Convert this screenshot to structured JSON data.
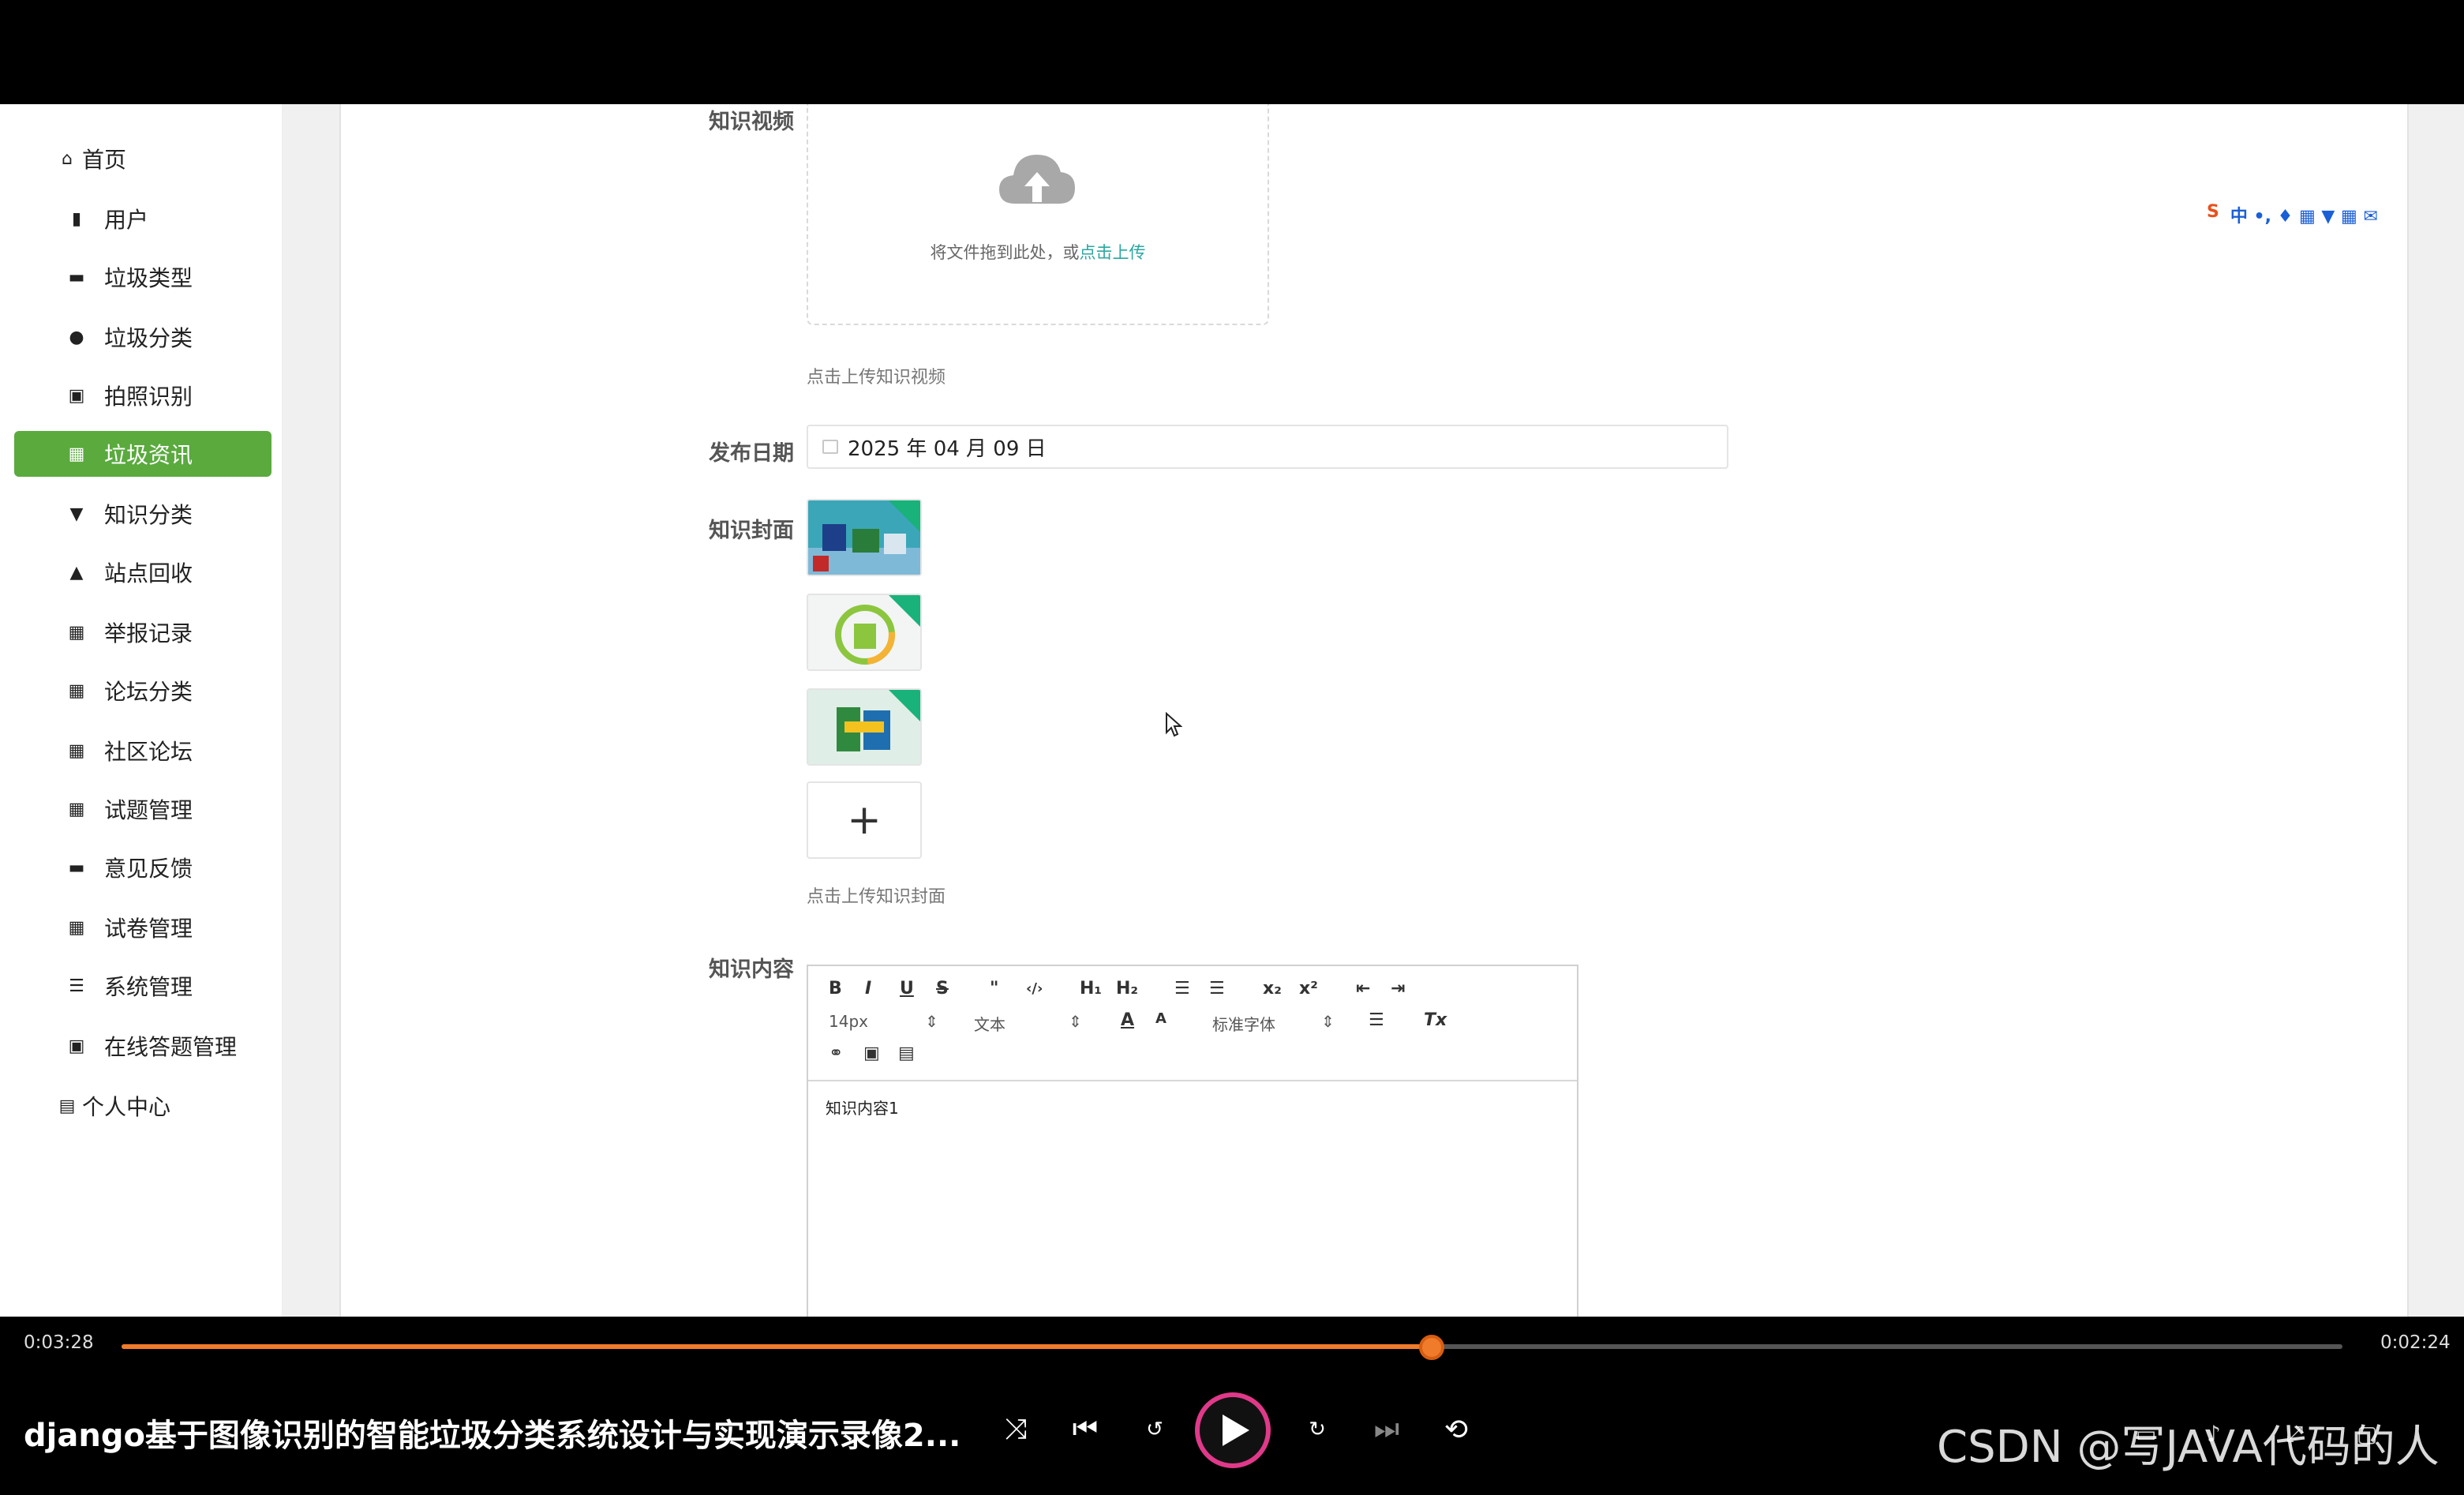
{
  "sidebar": {
    "items": [
      {
        "label": "首页",
        "icon": "home-icon",
        "glyph": "⌂",
        "top": true
      },
      {
        "label": "用户",
        "icon": "clipboard-icon",
        "glyph": "▮"
      },
      {
        "label": "垃圾类型",
        "icon": "monitor-icon",
        "glyph": "▬"
      },
      {
        "label": "垃圾分类",
        "icon": "user-icon",
        "glyph": "●"
      },
      {
        "label": "拍照识别",
        "icon": "clipboard-check-icon",
        "glyph": "▣"
      },
      {
        "label": "垃圾资讯",
        "icon": "grid-icon",
        "glyph": "▦",
        "active": true
      },
      {
        "label": "知识分类",
        "icon": "pin-icon",
        "glyph": "▼"
      },
      {
        "label": "站点回收",
        "icon": "person-icon",
        "glyph": "▲"
      },
      {
        "label": "举报记录",
        "icon": "grid-dots-icon",
        "glyph": "▦"
      },
      {
        "label": "论坛分类",
        "icon": "grid-icon",
        "glyph": "▦"
      },
      {
        "label": "社区论坛",
        "icon": "grid-icon",
        "glyph": "▦"
      },
      {
        "label": "试题管理",
        "icon": "grid-icon",
        "glyph": "▦"
      },
      {
        "label": "意见反馈",
        "icon": "briefcase-icon",
        "glyph": "▬"
      },
      {
        "label": "试卷管理",
        "icon": "grid-icon",
        "glyph": "▦"
      },
      {
        "label": "系统管理",
        "icon": "list-icon",
        "glyph": "☰"
      },
      {
        "label": "在线答题管理",
        "icon": "clipboard-x-icon",
        "glyph": "▣"
      },
      {
        "label": "个人中心",
        "icon": "card-icon",
        "glyph": "▤",
        "top": true
      }
    ]
  },
  "form": {
    "video_label": "知识视频",
    "upload_text": "将文件拖到此处，或",
    "upload_link": "点击上传",
    "video_hint": "点击上传知识视频",
    "date_label": "发布日期",
    "date_value": "2025 年 04 月 09 日",
    "cover_label": "知识封面",
    "add_symbol": "+",
    "cover_hint": "点击上传知识封面",
    "content_label": "知识内容",
    "content_value": "知识内容1"
  },
  "editor_toolbar": {
    "bold": "B",
    "italic": "I",
    "underline": "U",
    "strike": "S",
    "quote": "\"",
    "code": "‹/›",
    "h1": "H₁",
    "h2": "H₂",
    "ordered": "☰",
    "bullet": "☰",
    "sub": "x₂",
    "sup": "x²",
    "outdent": "⇤",
    "indent": "⇥",
    "size": "14px",
    "format": "文本",
    "color": "A",
    "bg": "A",
    "font": "标准字体",
    "align": "☰",
    "clear": "Tx",
    "link": "⚭",
    "image": "▣",
    "video": "▤"
  },
  "ime": {
    "logo": "S",
    "text": "中 •, ♦ ▦ ▼ ▦ ✉"
  },
  "player": {
    "elapsed": "0:03:28",
    "remaining": "0:02:24",
    "progress": 0.59,
    "title": "django基于图像识别的智能垃圾分类系统设计与实现演示录像2...",
    "watermark": "CSDN @写JAVA代码的人",
    "accent": "#f07b2a"
  }
}
